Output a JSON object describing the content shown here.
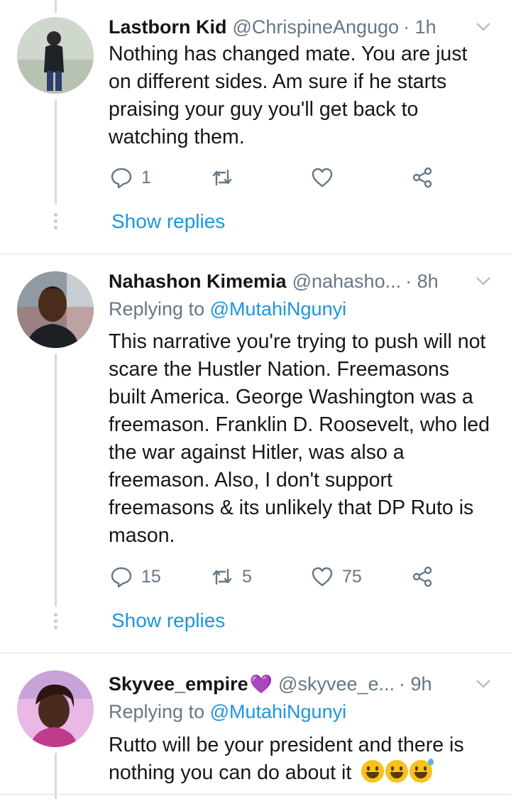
{
  "tweets": [
    {
      "name": "Lastborn Kid",
      "handle": "@ChrispineAngugo",
      "time": "· 1h",
      "reply_prefix": "",
      "reply_mention": "",
      "text": "Nothing has changed mate. You are just on different sides. Am sure if he starts praising your guy you'll get back to watching them.",
      "reply_count": "1",
      "retweet_count": "",
      "like_count": "",
      "show_replies": "Show replies"
    },
    {
      "name": "Nahashon Kimemia",
      "handle": "@nahasho...",
      "time": "· 8h",
      "reply_prefix": "Replying to ",
      "reply_mention": "@MutahiNgunyi",
      "text": "This narrative you're trying to push will not scare the Hustler Nation. Freemasons built America. George Washington was a freemason. Franklin D. Roosevelt, who led the war against Hitler, was also a freemason. Also, I don't support freemasons & its unlikely that DP Ruto is mason.",
      "reply_count": "15",
      "retweet_count": "5",
      "like_count": "75",
      "show_replies": "Show replies"
    },
    {
      "name": "Skyvee_empire",
      "name_emoji": "💜",
      "handle": "@skyvee_e...",
      "time": "· 9h",
      "reply_prefix": "Replying to ",
      "reply_mention": "@MutahiNgunyi",
      "text": "Rutto will be your president and there is nothing you can do about it"
    }
  ],
  "icons": {
    "reply": "reply-icon",
    "retweet": "retweet-icon",
    "like": "heart-icon",
    "share": "share-icon",
    "caret": "chevron-down-icon",
    "emoji": "grinning-face-emoji"
  },
  "colors": {
    "accent": "#1b95e0",
    "secondary_text": "#657786",
    "primary_text": "#14171a",
    "separator": "#d9dee2"
  }
}
